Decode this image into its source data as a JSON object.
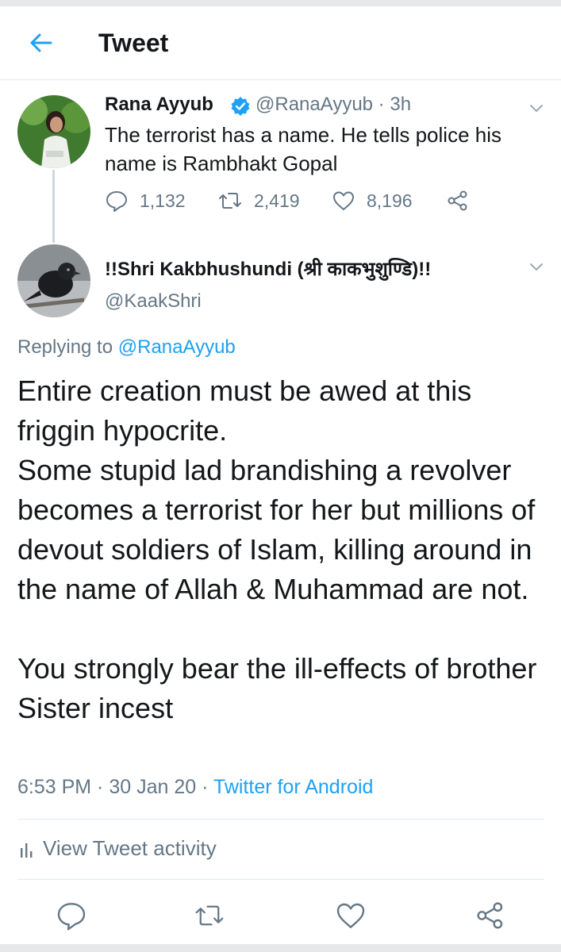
{
  "header": {
    "title": "Tweet"
  },
  "parent_tweet": {
    "name": "Rana Ayyub",
    "handle": "@RanaAyyub",
    "time": "3h",
    "text": "The terrorist has a name. He tells police his name is Rambhakt Gopal",
    "replies": "1,132",
    "retweets": "2,419",
    "likes": "8,196"
  },
  "reply_tweet": {
    "name": "!!Shri Kakbhushundi (श्री काकभुशुण्डि)!!",
    "handle": "@KaakShri",
    "replying_label": "Replying to",
    "replying_to": "@RanaAyyub",
    "text_paragraph_1": "Entire creation must be awed at this friggin hypocrite.",
    "text_paragraph_2": "Some stupid lad brandishing a revolver becomes a terrorist for her but millions of devout soldiers of Islam, killing around in the name of Allah & Muhammad are not.",
    "text_paragraph_3": "You strongly bear the ill-effects of brother Sister incest",
    "time": "6:53 PM",
    "date": "30 Jan 20",
    "source": "Twitter for Android"
  },
  "activity": {
    "label": "View Tweet activity"
  },
  "colors": {
    "accent": "#1da1f2",
    "text": "#14171a",
    "secondary": "#657786",
    "border": "#e1e8ed"
  },
  "icons": [
    "back-arrow-icon",
    "verified-badge-icon",
    "chevron-down-icon",
    "reply-icon",
    "retweet-icon",
    "like-icon",
    "share-icon",
    "activity-chart-icon"
  ]
}
